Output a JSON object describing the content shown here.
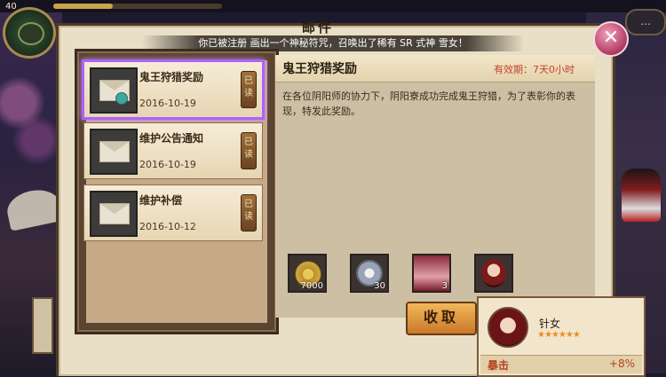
{
  "player": {
    "level": "40"
  },
  "window": {
    "title": "邮件"
  },
  "notice": {
    "text": "你已被注册 画出一个神秘符咒，召唤出了稀有 SR 式神 雪女！"
  },
  "close_label": "✕",
  "chat_label": "…",
  "mail_list": [
    {
      "title": "鬼王狩猎奖励",
      "date": "2016-10-19",
      "status": "已读",
      "selected": true
    },
    {
      "title": "维护公告通知",
      "date": "2016-10-19",
      "status": "已读",
      "selected": false
    },
    {
      "title": "维护补偿",
      "date": "2016-10-12",
      "status": "已读",
      "selected": false
    }
  ],
  "detail": {
    "title": "鬼王狩猎奖励",
    "expiry": "有效期：7天0小时",
    "body": "在各位阴阳师的协力下，阴阳寮成功完成鬼王狩猎，为了表彰你的表现，特发此奖励。"
  },
  "rewards": [
    {
      "icon": "coin-icon",
      "qty": "7000"
    },
    {
      "icon": "jade-icon",
      "qty": "30"
    },
    {
      "icon": "shikigami-card-icon",
      "qty": "3"
    },
    {
      "icon": "shikigami-portrait-icon",
      "qty": ""
    }
  ],
  "collect_label": "收取",
  "tooltip": {
    "name": "针女",
    "stars": "★★★★★★",
    "stat_name": "暴击",
    "stat_value": "+8%"
  },
  "colors": {
    "accent": "#b060ff",
    "expiry": "#c8402a",
    "button": "#f2b85a"
  }
}
